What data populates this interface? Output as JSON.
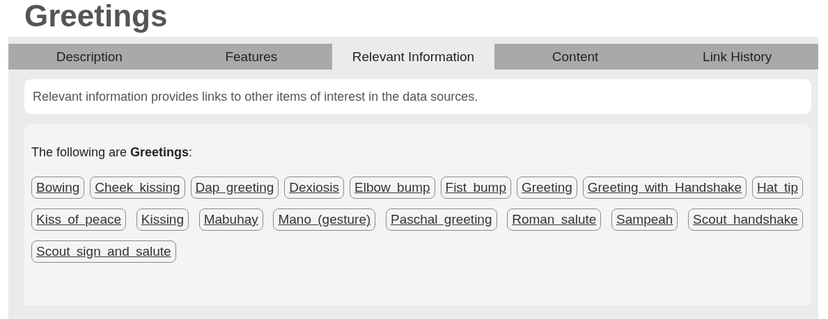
{
  "title": "Greetings",
  "tabs": [
    {
      "label": "Description",
      "selected": false
    },
    {
      "label": "Features",
      "selected": false
    },
    {
      "label": "Relevant Information",
      "selected": true
    },
    {
      "label": "Content",
      "selected": false
    },
    {
      "label": "Link History",
      "selected": false
    }
  ],
  "intro": "Relevant information provides links to other items of interest in the data sources.",
  "list_heading": "The following are **Greetings**:",
  "links": [
    "Bowing",
    "Cheek kissing",
    "Dap greeting",
    "Dexiosis",
    "Elbow bump",
    "Fist bump",
    "Greeting",
    "Greeting with Handshake",
    "Hat tip",
    "Kiss of peace",
    "Kissing",
    "Mabuhay",
    "Mano (gesture)",
    "Paschal greeting",
    "Roman salute",
    "Sampeah",
    "Scout handshake",
    "Scout sign and salute"
  ]
}
